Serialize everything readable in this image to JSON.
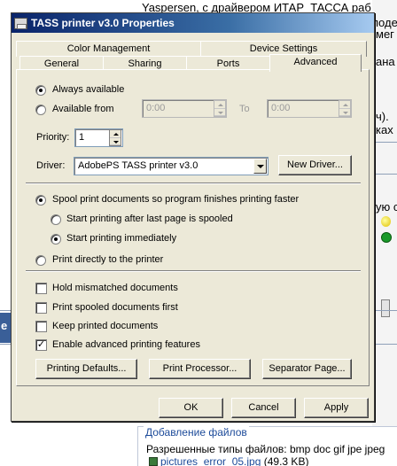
{
  "background": {
    "line1": "Yaspersen, с драйвером ИТАР_ТАССА раб",
    "line2": "поде",
    "line3": "мег",
    "line4": "ана",
    "line5": "ч).",
    "line6": "ках",
    "line7": "ую с",
    "left_fragment": "е",
    "upload_legend": "Добавление файлов",
    "allowed_types": "Разрешенные типы файлов: bmp doc gif jpe jpeg",
    "file_name": "pictures_error_05.jpg",
    "file_size": "(49.3 KB)"
  },
  "dialog": {
    "title": "TASS printer v3.0 Properties",
    "tabs_top": [
      "Color Management",
      "Device Settings"
    ],
    "tabs_bottom": [
      "General",
      "Sharing",
      "Ports",
      "Advanced"
    ],
    "active_tab": "Advanced",
    "always_available": "Always available",
    "available_from": "Available from",
    "from_time": "0:00",
    "to_label": "To",
    "to_time": "0:00",
    "priority_label": "Priority:",
    "priority_value": "1",
    "driver_label": "Driver:",
    "driver_value": "AdobePS TASS printer v3.0",
    "new_driver": "New Driver...",
    "spool": "Spool print documents so program finishes printing faster",
    "start_after_last": "Start printing after last page is spooled",
    "start_immediately": "Start printing immediately",
    "print_directly": "Print directly to the printer",
    "hold_mismatched": "Hold mismatched documents",
    "print_spooled_first": "Print spooled documents first",
    "keep_printed": "Keep printed documents",
    "enable_advanced": "Enable advanced printing features",
    "printing_defaults": "Printing Defaults...",
    "print_processor": "Print Processor...",
    "separator_page": "Separator Page...",
    "ok": "OK",
    "cancel": "Cancel",
    "apply": "Apply"
  },
  "state": {
    "always_available_selected": true,
    "spool_selected": true,
    "start_immediately_selected": true,
    "enable_advanced_checked": true,
    "hold_mismatched_checked": false,
    "print_spooled_first_checked": false,
    "keep_printed_checked": false
  }
}
